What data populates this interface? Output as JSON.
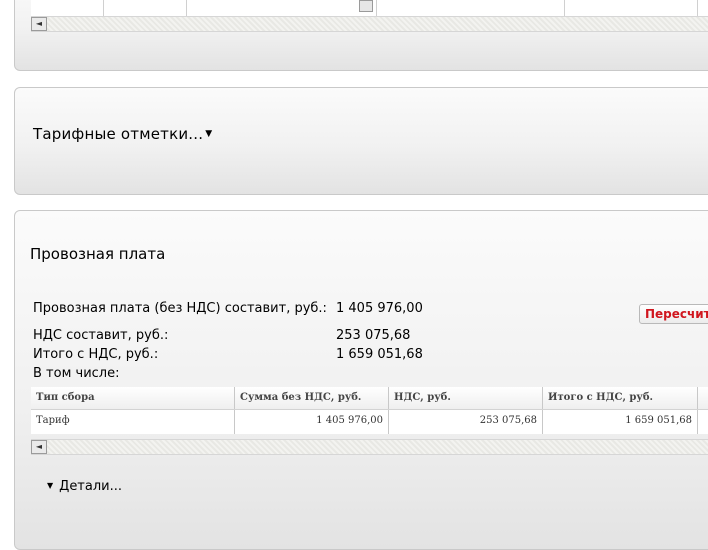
{
  "tariff_marks": {
    "title": "Тарифные отметки...",
    "caret": "▼"
  },
  "carriage_fee": {
    "title": "Провозная плата",
    "rows": [
      {
        "label": "Провозная плата (без НДС) составит, руб.:",
        "value": "1 405 976,00"
      },
      {
        "label": "НДС составит, руб.:",
        "value": "253 075,68"
      },
      {
        "label": "Итого с НДС, руб.:",
        "value": "1 659 051,68"
      },
      {
        "label": "В том числе:",
        "value": ""
      }
    ],
    "recalc_label": "Пересчитать",
    "table": {
      "headers": [
        "Тип сбора",
        "Сумма без НДС, руб.",
        "НДС, руб.",
        "Итого с НДС, руб."
      ],
      "rows": [
        [
          "Тариф",
          "1 405 976,00",
          "253 075,68",
          "1 659 051,68"
        ]
      ]
    },
    "details_label": "Детали...",
    "details_icon": "▼"
  },
  "scroll_left_icon": "◄"
}
